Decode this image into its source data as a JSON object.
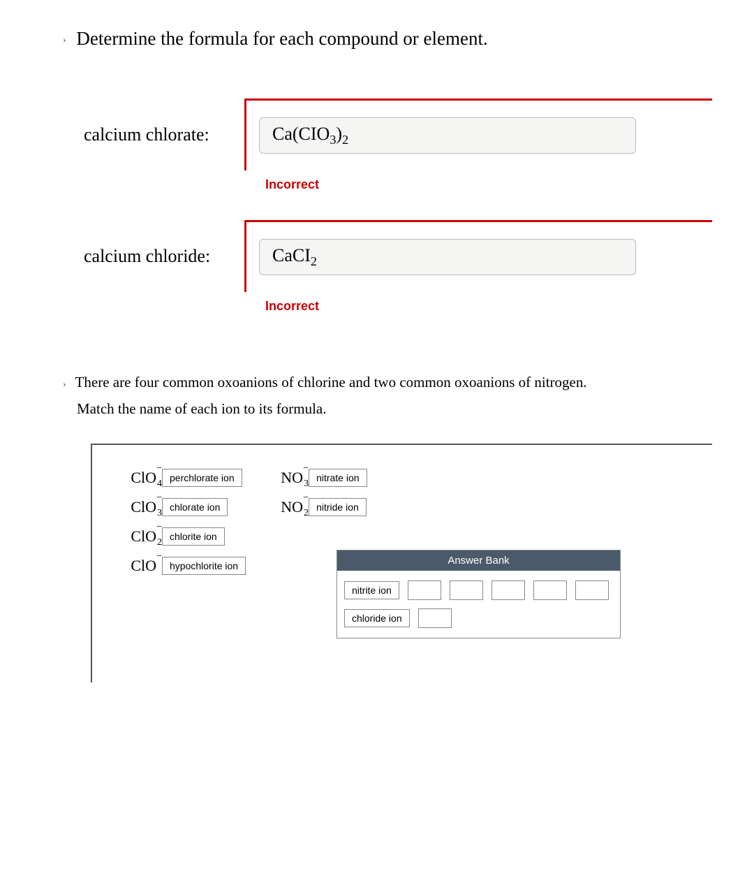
{
  "page_title": "Determine the formula for each compound or element.",
  "q1": {
    "items": [
      {
        "label": "calcium chlorate:",
        "answer_html": "Ca(CIO<sub>3</sub>)<sub>2</sub>",
        "feedback": "Incorrect"
      },
      {
        "label": "calcium chloride:",
        "answer_html": "CaCI<sub>2</sub>",
        "feedback": "Incorrect"
      }
    ]
  },
  "q2": {
    "prompt_line1": "There are four common oxoanions of chlorine and two common oxoanions of nitrogen.",
    "prompt_line2": "Match the name of each ion to its formula.",
    "col1": [
      {
        "formula": {
          "base": "ClO",
          "sub": "4",
          "sup": "−"
        },
        "match": "perchlorate ion"
      },
      {
        "formula": {
          "base": "ClO",
          "sub": "3",
          "sup": "−"
        },
        "match": "chlorate ion"
      },
      {
        "formula": {
          "base": "ClO",
          "sub": "2",
          "sup": "−"
        },
        "match": "chlorite ion"
      },
      {
        "formula": {
          "base": "ClO",
          "sub": "",
          "sup": "−"
        },
        "match": "hypochlorite ion"
      }
    ],
    "col2": [
      {
        "formula": {
          "base": "NO",
          "sub": "3",
          "sup": "−"
        },
        "match": "nitrate ion"
      },
      {
        "formula": {
          "base": "NO",
          "sub": "2",
          "sup": "−"
        },
        "match": "nitride ion"
      }
    ],
    "answer_bank": {
      "title": "Answer Bank",
      "tiles": [
        "nitrite ion",
        "",
        "",
        "",
        "",
        "",
        "chloride ion",
        ""
      ]
    }
  }
}
